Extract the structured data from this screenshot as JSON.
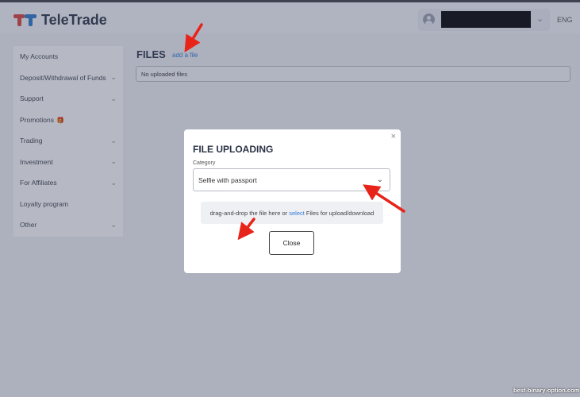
{
  "header": {
    "logo_text": "TeleTrade",
    "language": "ENG",
    "user_chevron": "⌄"
  },
  "sidebar": {
    "items": [
      {
        "label": "My Accounts",
        "chevron": ""
      },
      {
        "label": "Deposit/Withdrawal of Funds",
        "chevron": "⌄"
      },
      {
        "label": "Support",
        "chevron": "⌄"
      },
      {
        "label": "Promotions",
        "chevron": ""
      },
      {
        "label": "Trading",
        "chevron": "⌄"
      },
      {
        "label": "Investment",
        "chevron": "⌄"
      },
      {
        "label": "For Affiliates",
        "chevron": "⌄"
      },
      {
        "label": "Loyalty program",
        "chevron": ""
      },
      {
        "label": "Other",
        "chevron": "⌄"
      }
    ]
  },
  "main": {
    "title": "FILES",
    "add_file": "add a file",
    "empty_text": "No uploaded files"
  },
  "modal": {
    "close_symbol": "×",
    "title": "FILE UPLOADING",
    "category_label": "Category",
    "category_value": "Selfie with passport",
    "dropzone_prefix": "drag-and-drop the file here or ",
    "dropzone_link": "select",
    "dropzone_suffix": " Files for upload/download",
    "close_button": "Close"
  },
  "watermark": "best-binary-option.com",
  "colors": {
    "brand_red": "#d9423a",
    "brand_blue": "#2a77c7",
    "link": "#2f7bd6",
    "annotation_arrow": "#e8231a"
  }
}
